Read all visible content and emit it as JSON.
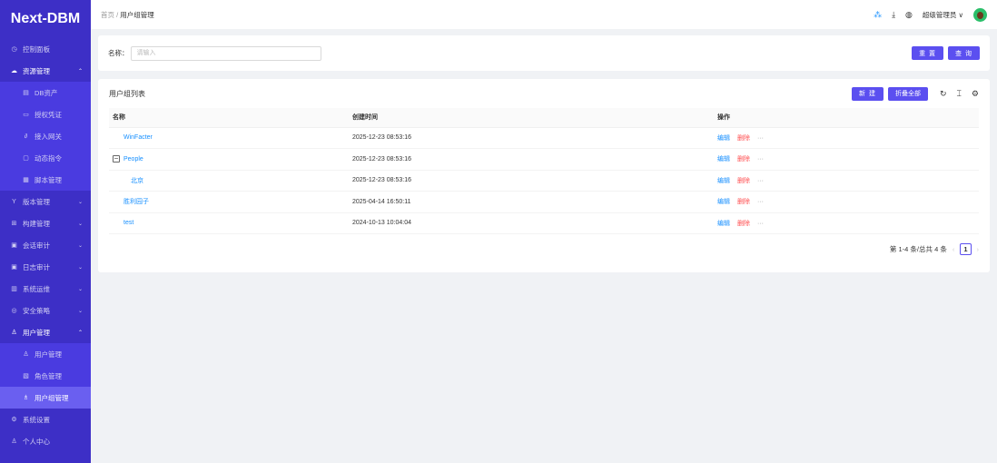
{
  "app": {
    "logo": "Next-DBM"
  },
  "sidebar": {
    "items": [
      {
        "label": "控制面板",
        "icon": "dashboard-icon",
        "type": "top"
      },
      {
        "label": "资源管理",
        "icon": "cloud-icon",
        "type": "open",
        "chevron": "up"
      },
      {
        "label": "DB资产",
        "icon": "database-icon",
        "type": "sub"
      },
      {
        "label": "授权凭证",
        "icon": "credential-icon",
        "type": "sub"
      },
      {
        "label": "接入网关",
        "icon": "link-icon",
        "type": "sub"
      },
      {
        "label": "动态指令",
        "icon": "code-icon",
        "type": "sub"
      },
      {
        "label": "脚本管理",
        "icon": "script-icon",
        "type": "sub"
      },
      {
        "label": "版本管理",
        "icon": "branch-icon",
        "type": "top",
        "chevron": "down"
      },
      {
        "label": "构建管理",
        "icon": "build-icon",
        "type": "top",
        "chevron": "down"
      },
      {
        "label": "会话审计",
        "icon": "audit-icon",
        "type": "top",
        "chevron": "down"
      },
      {
        "label": "日志审计",
        "icon": "log-icon",
        "type": "top",
        "chevron": "down"
      },
      {
        "label": "系统运维",
        "icon": "ops-icon",
        "type": "top",
        "chevron": "down"
      },
      {
        "label": "安全策略",
        "icon": "shield-icon",
        "type": "top",
        "chevron": "down"
      },
      {
        "label": "用户管理",
        "icon": "user-icon",
        "type": "open",
        "chevron": "up"
      },
      {
        "label": "用户管理",
        "icon": "user-icon",
        "type": "sub"
      },
      {
        "label": "角色管理",
        "icon": "role-icon",
        "type": "sub"
      },
      {
        "label": "用户组管理",
        "icon": "group-icon",
        "type": "sub sel"
      },
      {
        "label": "系统设置",
        "icon": "settings-icon",
        "type": "top"
      },
      {
        "label": "个人中心",
        "icon": "user-icon",
        "type": "top"
      }
    ]
  },
  "header": {
    "breadcrumb": [
      "首页",
      "用户组管理"
    ],
    "user": "超级管理员"
  },
  "search": {
    "label": "名称：",
    "placeholder": "请输入",
    "value": "",
    "reset": "重 置",
    "query": "查 询"
  },
  "table": {
    "title": "用户组列表",
    "new": "新 建",
    "collapse": "折叠全部",
    "columns": [
      "名称",
      "创建时间",
      "操作"
    ],
    "rows": [
      {
        "name": "WinFacter",
        "created": "2025-12-23 08:53:16",
        "indent": 0,
        "expander": false
      },
      {
        "name": "People",
        "created": "2025-12-23 08:53:16",
        "indent": 0,
        "expander": true
      },
      {
        "name": "北京",
        "created": "2025-12-23 08:53:16",
        "indent": 1,
        "expander": false
      },
      {
        "name": "胜利园子",
        "created": "2025-04-14 16:50:11",
        "indent": 0,
        "expander": false
      },
      {
        "name": "test",
        "created": "2024-10-13 10:04:04",
        "indent": 0,
        "expander": false
      }
    ],
    "edit": "编辑",
    "delete": "删除",
    "more": "···"
  },
  "pagination": {
    "summary": "第 1-4 条/总共 4 条",
    "current": "1"
  },
  "colors": {
    "sidebar": "#3d2fc6",
    "primary": "#5b4ff0",
    "link": "#1890ff",
    "danger": "#ff4d4f"
  }
}
